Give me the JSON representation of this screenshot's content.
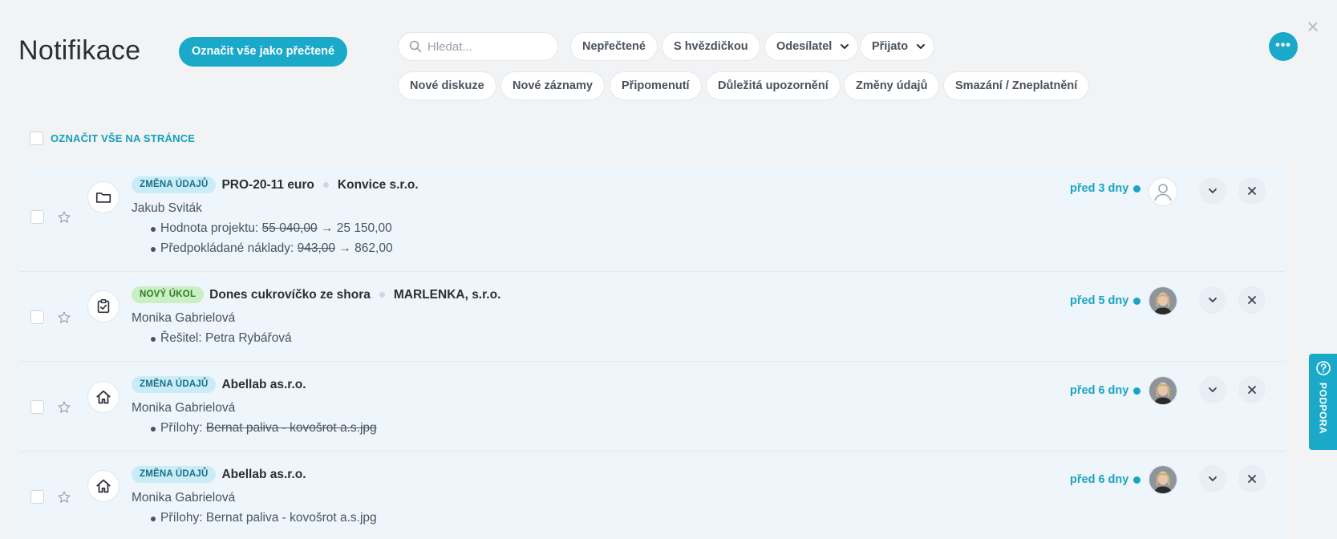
{
  "header": {
    "title": "Notifikace",
    "mark_all_read": "Označit vše jako přečtené",
    "search_placeholder": "Hledat...",
    "filters_row1": [
      "Nepřečtené",
      "S hvězdičkou",
      "Odesílatel",
      "Přijato"
    ],
    "filters_row2": [
      "Nové diskuze",
      "Nové záznamy",
      "Připomenutí",
      "Důležitá upozornění",
      "Změny údajů",
      "Smazání / Zneplatnění"
    ]
  },
  "select_all_label": "OZNAČIT VŠE NA STRÁNCE",
  "support_label": "PODPORA",
  "colors": {
    "accent": "#1ba9c9",
    "change_badge": "#c9ecf7",
    "task_badge": "#c9efc2"
  },
  "notifications": [
    {
      "badge": "ZMĚNA ÚDAJŮ",
      "subject": "PRO-20-11 euro",
      "company": "Konvice s.r.o.",
      "author": "Jakub Sviták",
      "icon": "folder-icon",
      "time": "před 3 dny",
      "lines": [
        {
          "label": "Hodnota projektu: ",
          "old": "55 040,00",
          "arrow": " → ",
          "new": "25 150,00"
        },
        {
          "label": "Předpokládané náklady: ",
          "old": "943,00",
          "arrow": " → ",
          "new": "862,00"
        }
      ]
    },
    {
      "badge": "NOVÝ ÚKOL",
      "subject": "Dones cukrovíčko ze shora",
      "company": "MARLENKA, s.r.o.",
      "author": "Monika Gabrielová",
      "icon": "task-check-icon",
      "time": "před 5 dny",
      "lines": [
        {
          "text": "Řešitel: Petra Rybářová"
        }
      ]
    },
    {
      "badge": "ZMĚNA ÚDAJŮ",
      "subject": "Abellab as.r.o.",
      "author": "Monika Gabrielová",
      "icon": "home-icon",
      "time": "před 6 dny",
      "lines": [
        {
          "label": "Přílohy: ",
          "old": "Bernat paliva - kovošrot a.s.jpg"
        }
      ]
    },
    {
      "badge": "ZMĚNA ÚDAJŮ",
      "subject": "Abellab as.r.o.",
      "author": "Monika Gabrielová",
      "icon": "home-icon",
      "time": "před 6 dny",
      "lines": [
        {
          "text": "Přílohy: Bernat paliva - kovošrot a.s.jpg"
        }
      ]
    }
  ]
}
